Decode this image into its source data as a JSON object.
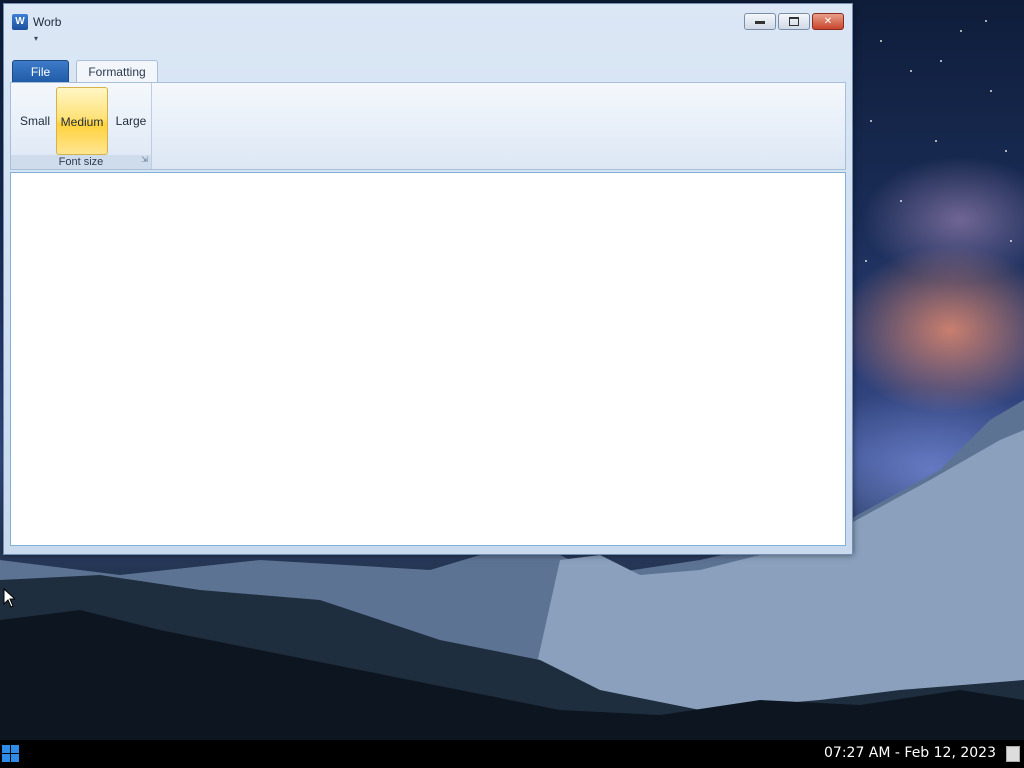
{
  "window": {
    "title": "Worb",
    "icon": "word-app-icon",
    "controls": {
      "minimize": "minimize-icon",
      "maximize": "maximize-icon",
      "close": "✕"
    }
  },
  "ribbon": {
    "tabs": [
      {
        "label": "File",
        "active": false
      },
      {
        "label": "Formatting",
        "active": true
      }
    ],
    "font_size_group": {
      "label": "Font size",
      "buttons": [
        {
          "label": "Small",
          "selected": false
        },
        {
          "label": "Medium",
          "selected": true
        },
        {
          "label": "Large",
          "selected": false
        }
      ]
    }
  },
  "editor": {
    "content": ""
  },
  "taskbar": {
    "clock": "07:27 AM - Feb 12, 2023",
    "start_icon": "windows-logo-icon"
  },
  "colors": {
    "file_tab": "#1f5aa6",
    "selected_button": "#ffd23c",
    "close_button": "#c9442c"
  }
}
